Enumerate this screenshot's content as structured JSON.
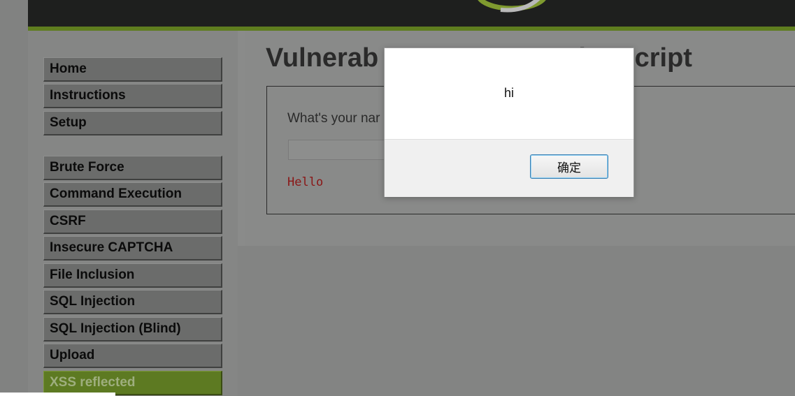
{
  "sidebar": {
    "items": [
      {
        "label": "Home"
      },
      {
        "label": "Instructions"
      },
      {
        "label": "Setup"
      },
      {
        "label": "Brute Force"
      },
      {
        "label": "Command Execution"
      },
      {
        "label": "CSRF"
      },
      {
        "label": "Insecure CAPTCHA"
      },
      {
        "label": "File Inclusion"
      },
      {
        "label": "SQL Injection"
      },
      {
        "label": "SQL Injection (Blind)"
      },
      {
        "label": "Upload"
      },
      {
        "label": "XSS reflected"
      }
    ],
    "active_item": "XSS reflected"
  },
  "main": {
    "title_left": "Vulnerab",
    "title_right": "ss Site Script",
    "form_label": "What's your nar",
    "name_input_value": "",
    "output_text": "Hello"
  },
  "alert": {
    "message": "hi",
    "ok_label": "确定"
  },
  "colors": {
    "header": "#1e1f1e",
    "header_stripe": "#5f7d1f",
    "active_item": "#5d7a22",
    "output_text": "#8a1616"
  },
  "icons": {
    "logo": "dvwa-logo-swirl"
  }
}
